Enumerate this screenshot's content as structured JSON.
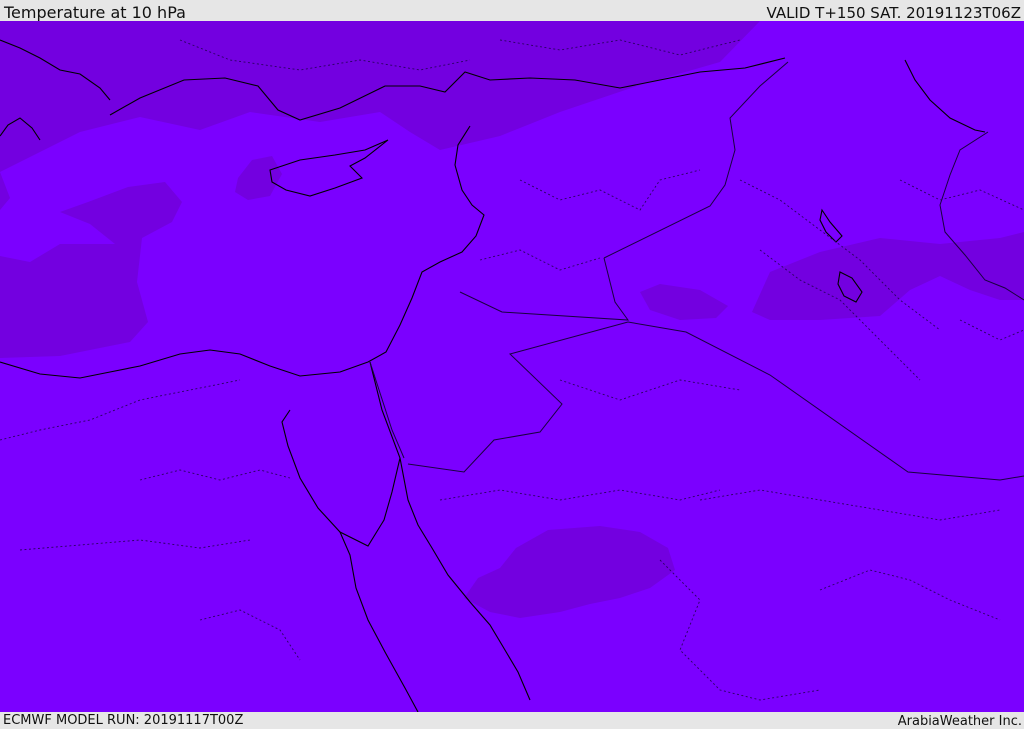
{
  "header": {
    "title": "Temperature at 10 hPa",
    "valid_time": "VALID T+150 SAT. 20191123T06Z"
  },
  "footer": {
    "model_run": "ECMWF MODEL RUN: 20191117T00Z",
    "credit": "ArabiaWeather Inc."
  },
  "map": {
    "colors": {
      "base_fill": "#7b00ff",
      "cooler_fill": "#7300e0",
      "coastline": "#000000",
      "borders": "#1a0040"
    }
  }
}
